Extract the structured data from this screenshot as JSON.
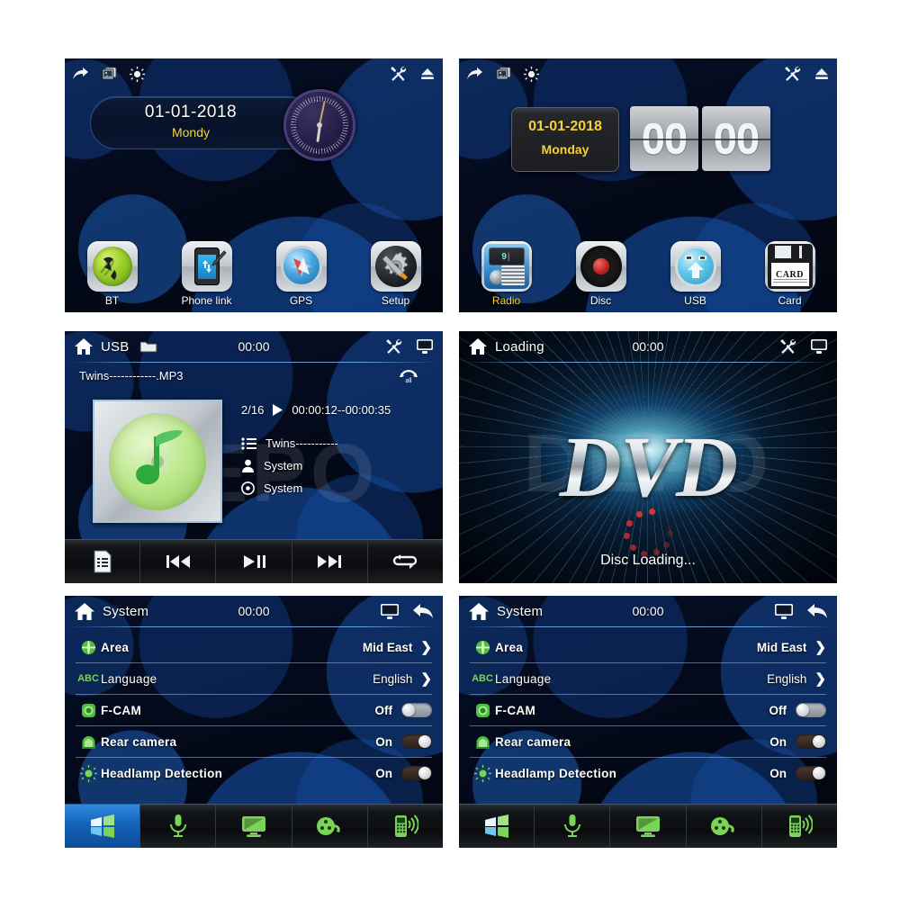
{
  "panels": {
    "home_analog": {
      "topbar": {
        "left_icons": [
          "share-arrow-icon",
          "gallery-icon",
          "brightness-icon"
        ],
        "right_icons": [
          "tools-icon",
          "eject-icon"
        ]
      },
      "widget": {
        "date": "01-01-2018",
        "day": "Mondy"
      },
      "apps": [
        {
          "label": "BT",
          "icon": "bluetooth-phone-icon",
          "highlight": false
        },
        {
          "label": "Phone link",
          "icon": "phone-link-icon",
          "highlight": false
        },
        {
          "label": "GPS",
          "icon": "compass-icon",
          "highlight": false
        },
        {
          "label": "Setup",
          "icon": "gear-wrench-icon",
          "highlight": false
        }
      ]
    },
    "home_flip": {
      "topbar": {
        "left_icons": [
          "share-arrow-icon",
          "gallery-icon",
          "brightness-icon"
        ],
        "right_icons": [
          "tools-icon",
          "eject-icon"
        ]
      },
      "widget": {
        "date": "01-01-2018",
        "day": "Monday",
        "hours": "00",
        "minutes": "00"
      },
      "apps": [
        {
          "label": "Radio",
          "icon": "radio-icon",
          "highlight": true
        },
        {
          "label": "Disc",
          "icon": "vinyl-disc-icon",
          "highlight": false
        },
        {
          "label": "USB",
          "icon": "usb-icon",
          "highlight": false
        },
        {
          "label": "Card",
          "icon": "sd-card-icon",
          "highlight": false
        }
      ]
    },
    "usb_player": {
      "header": {
        "home_icon": "home-icon",
        "title": "USB",
        "folder_icon": "folder-icon",
        "clock": "00:00",
        "right_icons": [
          "tools-icon",
          "monitor-icon"
        ]
      },
      "track_file": "Twins------------.MP3",
      "repeat_icon": "repeat-all-icon",
      "track_index": "2/16",
      "play_icon": "play-icon",
      "time_range": "00:00:12--00:00:35",
      "meta": [
        {
          "icon": "list-icon",
          "text": "Twins-----------"
        },
        {
          "icon": "artist-icon",
          "text": "System"
        },
        {
          "icon": "album-icon",
          "text": "System"
        }
      ],
      "controls": [
        "playlist-icon",
        "previous-track-icon",
        "play-pause-icon",
        "next-track-icon",
        "repeat-icon"
      ]
    },
    "dvd_loading": {
      "header": {
        "home_icon": "home-icon",
        "title": "Loading",
        "clock": "00:00",
        "right_icons": [
          "tools-icon",
          "monitor-icon"
        ]
      },
      "logo_text": "DVD",
      "caption": "Disc Loading..."
    },
    "system_left": {
      "header": {
        "home_icon": "home-icon",
        "title": "System",
        "clock": "00:00",
        "right_icons": [
          "monitor-icon",
          "back-arrow-icon"
        ]
      },
      "rows": [
        {
          "icon": "globe-icon",
          "label": "Area",
          "value": "Mid East",
          "control": "chevron"
        },
        {
          "icon": "abc-icon",
          "label": "Language",
          "value": "English",
          "control": "chevron"
        },
        {
          "icon": "front-camera-icon",
          "label": "F-CAM",
          "value": "Off",
          "control": "toggle-off"
        },
        {
          "icon": "rear-camera-icon",
          "label": "Rear camera",
          "value": "On",
          "control": "toggle-on"
        },
        {
          "icon": "headlamp-icon",
          "label": "Headlamp Detection",
          "value": "On",
          "control": "toggle-on"
        }
      ],
      "taskbar": [
        {
          "icon": "windows-start-icon",
          "active": true
        },
        {
          "icon": "microphone-icon",
          "active": false
        },
        {
          "icon": "monitor-icon",
          "active": false
        },
        {
          "icon": "film-reel-icon",
          "active": false
        },
        {
          "icon": "mobile-signal-icon",
          "active": false
        }
      ]
    },
    "system_right": {
      "header": {
        "home_icon": "home-icon",
        "title": "System",
        "clock": "00:00",
        "right_icons": [
          "monitor-icon",
          "back-arrow-icon"
        ]
      },
      "rows": [
        {
          "icon": "globe-icon",
          "label": "Area",
          "value": "Mid East",
          "control": "chevron"
        },
        {
          "icon": "abc-icon",
          "label": "Language",
          "value": "English",
          "control": "chevron"
        },
        {
          "icon": "front-camera-icon",
          "label": "F-CAM",
          "value": "Off",
          "control": "toggle-off"
        },
        {
          "icon": "rear-camera-icon",
          "label": "Rear camera",
          "value": "On",
          "control": "toggle-on"
        },
        {
          "icon": "headlamp-icon",
          "label": "Headlamp Detection",
          "value": "On",
          "control": "toggle-on"
        }
      ],
      "taskbar": [
        {
          "icon": "windows-start-icon",
          "active": false
        },
        {
          "icon": "microphone-icon",
          "active": false
        },
        {
          "icon": "monitor-icon",
          "active": false
        },
        {
          "icon": "film-reel-icon",
          "active": false
        },
        {
          "icon": "mobile-signal-icon",
          "active": false
        }
      ]
    }
  },
  "watermark": "DEPO",
  "colors": {
    "accent_yellow": "#f5d235",
    "accent_blue": "#1463b8",
    "icon_green": "#7bd455",
    "panel_bg": "#050a18"
  },
  "glyphs": {
    "abc": "ABC",
    "chevron": "❯",
    "play": "▶"
  }
}
